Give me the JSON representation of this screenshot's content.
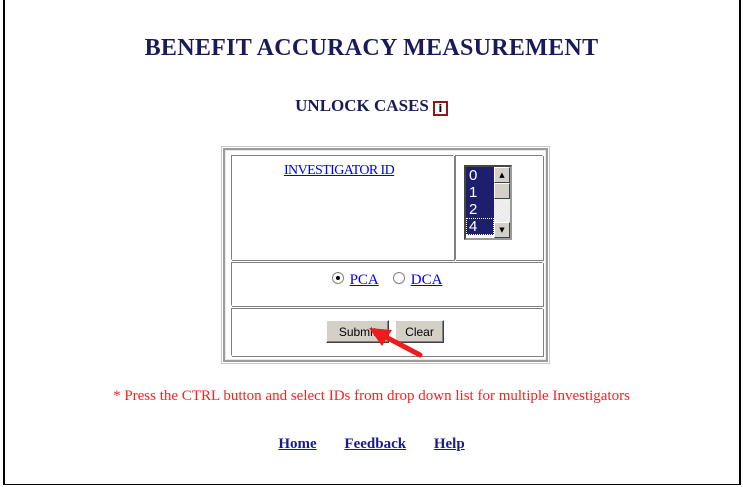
{
  "page": {
    "title": "BENEFIT ACCURACY MEASUREMENT",
    "subtitle": "UNLOCK CASES",
    "info_icon_glyph": "i"
  },
  "form": {
    "investigator_link": "INVESTIGATOR ID",
    "listbox_options": [
      "0",
      "1",
      "2",
      "4"
    ],
    "radio_options": [
      {
        "label": "PCA",
        "checked": true
      },
      {
        "label": "DCA",
        "checked": false
      }
    ],
    "submit_label": "Submit",
    "clear_label": "Clear"
  },
  "note": "* Press the CTRL button and select IDs from drop down list for multiple Investigators",
  "footer": {
    "links": [
      "Home",
      "Feedback",
      "Help"
    ]
  },
  "colors": {
    "heading": "#1a1a5a",
    "note": "#ff2020",
    "link": "#0000ee",
    "selection": "#1e1e6e",
    "annotation_arrow": "#ee1c1c"
  },
  "icons": {
    "info": "info-icon",
    "scroll_up": "up-arrow-icon",
    "scroll_down": "down-arrow-icon",
    "annotation": "red-arrow-icon"
  }
}
